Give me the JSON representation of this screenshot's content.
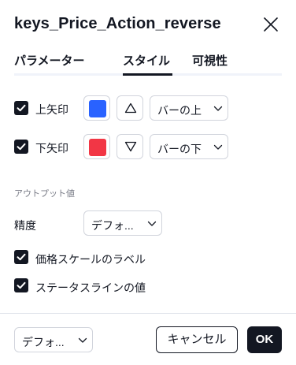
{
  "dialog": {
    "title": "keys_Price_Action_reverse",
    "close_icon": "close-icon"
  },
  "tabs": [
    {
      "label": "パラメーター",
      "active": false
    },
    {
      "label": "スタイル",
      "active": true
    },
    {
      "label": "可視性",
      "active": false
    }
  ],
  "style": {
    "up_arrow": {
      "label": "上矢印",
      "checked": true,
      "color": "#2962ff",
      "shape_icon": "triangle-up-icon",
      "position": "バーの上"
    },
    "down_arrow": {
      "label": "下矢印",
      "checked": true,
      "color": "#f23645",
      "shape_icon": "triangle-down-icon",
      "position": "バーの下"
    }
  },
  "output": {
    "section_label": "アウトプット値",
    "precision_label": "精度",
    "precision_value": "デフォ...",
    "scale_labels": {
      "label": "価格スケールのラベル",
      "checked": true
    },
    "status_line": {
      "label": "ステータスラインの値",
      "checked": true
    }
  },
  "footer": {
    "defaults_value": "デフォ...",
    "cancel_label": "キャンセル",
    "ok_label": "OK"
  }
}
